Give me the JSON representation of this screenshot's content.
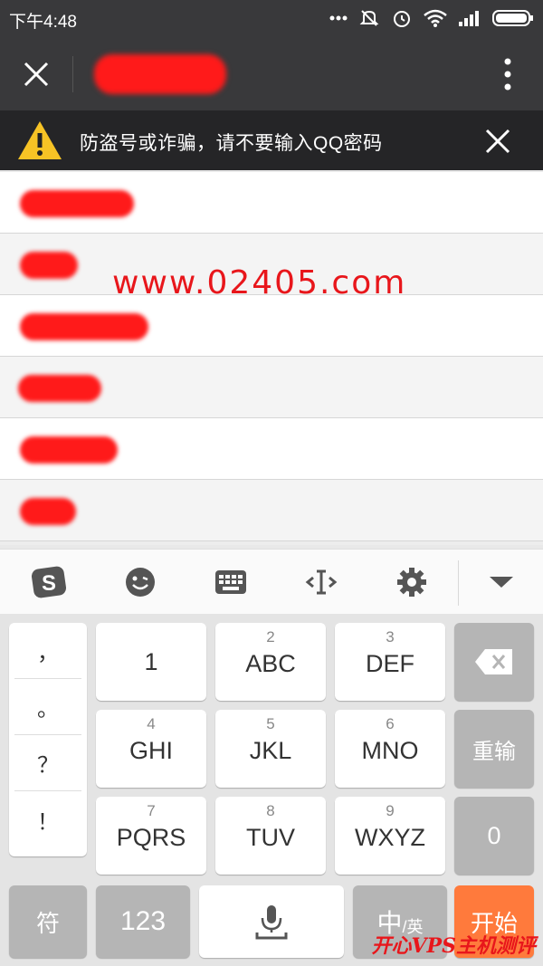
{
  "status_bar": {
    "time": "下午4:48"
  },
  "warning": {
    "text": "防盗号或诈骗，请不要输入QQ密码"
  },
  "watermark": {
    "text": "www.02405.com"
  },
  "keyboard": {
    "symbols": [
      "，",
      "。",
      "？",
      "！"
    ],
    "keys": [
      {
        "num": "",
        "letters": "1"
      },
      {
        "num": "2",
        "letters": "ABC"
      },
      {
        "num": "3",
        "letters": "DEF"
      },
      {
        "num": "4",
        "letters": "GHI"
      },
      {
        "num": "5",
        "letters": "JKL"
      },
      {
        "num": "6",
        "letters": "MNO"
      },
      {
        "num": "7",
        "letters": "PQRS"
      },
      {
        "num": "8",
        "letters": "TUV"
      },
      {
        "num": "9",
        "letters": "WXYZ"
      }
    ],
    "retype_label": "重输",
    "zero_label": "0",
    "symbol_label": "符",
    "numeric_label": "123",
    "lang_label_main": "中",
    "lang_label_sub": "/英",
    "start_label": "开始"
  },
  "footer_mark": "开心VPS主机测评",
  "colors": {
    "accent": "#ff7a3c",
    "dark": "#39393b",
    "redact": "#ff1a1a"
  }
}
